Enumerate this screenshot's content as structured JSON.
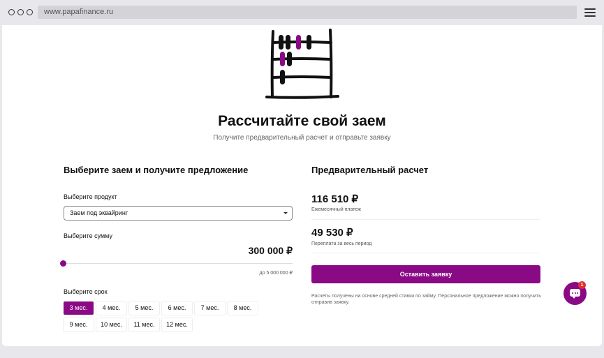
{
  "browser": {
    "url": "www.papafinance.ru"
  },
  "hero": {
    "title": "Рассчитайте свой заем",
    "subtitle": "Получите предварительный расчет и отправьте заявку"
  },
  "form": {
    "heading": "Выберите заем и получите предложение",
    "product_label": "Выберите продукт",
    "product_value": "Заем под эквайринг",
    "amount_label": "Выберите сумму",
    "amount_value": "300 000 ₽",
    "amount_fraction": 0.06,
    "amount_max": "до 5 000 000 ₽",
    "term_label": "Выберите срок",
    "terms": [
      "3 мес.",
      "4 мес.",
      "5 мес.",
      "6 мес.",
      "7 мес.",
      "8 мес.",
      "9 мес.",
      "10 мес.",
      "11 мес.",
      "12 мес."
    ],
    "selected_term": "3 мес."
  },
  "result": {
    "heading": "Предварительный расчет",
    "monthly_value": "116 510 ₽",
    "monthly_caption": "Ежемесячный платеж",
    "overpay_value": "49 530 ₽",
    "overpay_caption": "Переплата за весь период",
    "cta_label": "Оставить заявку",
    "note": "Расчеты получены на основе средней ставки по займу. Персональное предложение можно получить отправив заявку."
  },
  "chat": {
    "badge": "1"
  },
  "colors": {
    "accent": "#8a0a85",
    "badge": "#e03030",
    "chrome": "#e8e8ec"
  },
  "icons": [
    "window-dots-icon",
    "hamburger-menu-icon",
    "abacus-icon",
    "dropdown-caret-icon",
    "chat-icon"
  ]
}
